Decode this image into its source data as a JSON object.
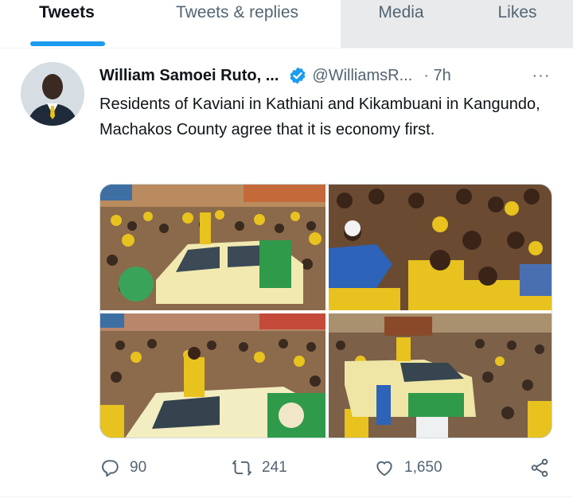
{
  "tabs": [
    {
      "label": "Tweets",
      "active": true
    },
    {
      "label": "Tweets & replies",
      "active": false
    },
    {
      "label": "Media",
      "active": false
    },
    {
      "label": "Likes",
      "active": false
    }
  ],
  "tweet": {
    "author_name": "William Samoei Ruto, ...",
    "handle": "@WilliamsR...",
    "time": "· 7h",
    "more_icon": "···",
    "text": "Residents of Kaviani in Kathiani and Kikambuani in Kangundo, Machakos County agree that it is economy first.",
    "media": [
      {
        "icon": "photo-rally-crowd"
      },
      {
        "icon": "photo-crowd-closeup"
      },
      {
        "icon": "photo-rally-car"
      },
      {
        "icon": "photo-convoy-crowd"
      }
    ],
    "actions": {
      "reply_count": "90",
      "retweet_count": "241",
      "like_count": "1,650"
    }
  },
  "colors": {
    "accent": "#1d9bf0",
    "secondary_text": "#536471",
    "inactive_tab_bg": "#e8eaec"
  }
}
